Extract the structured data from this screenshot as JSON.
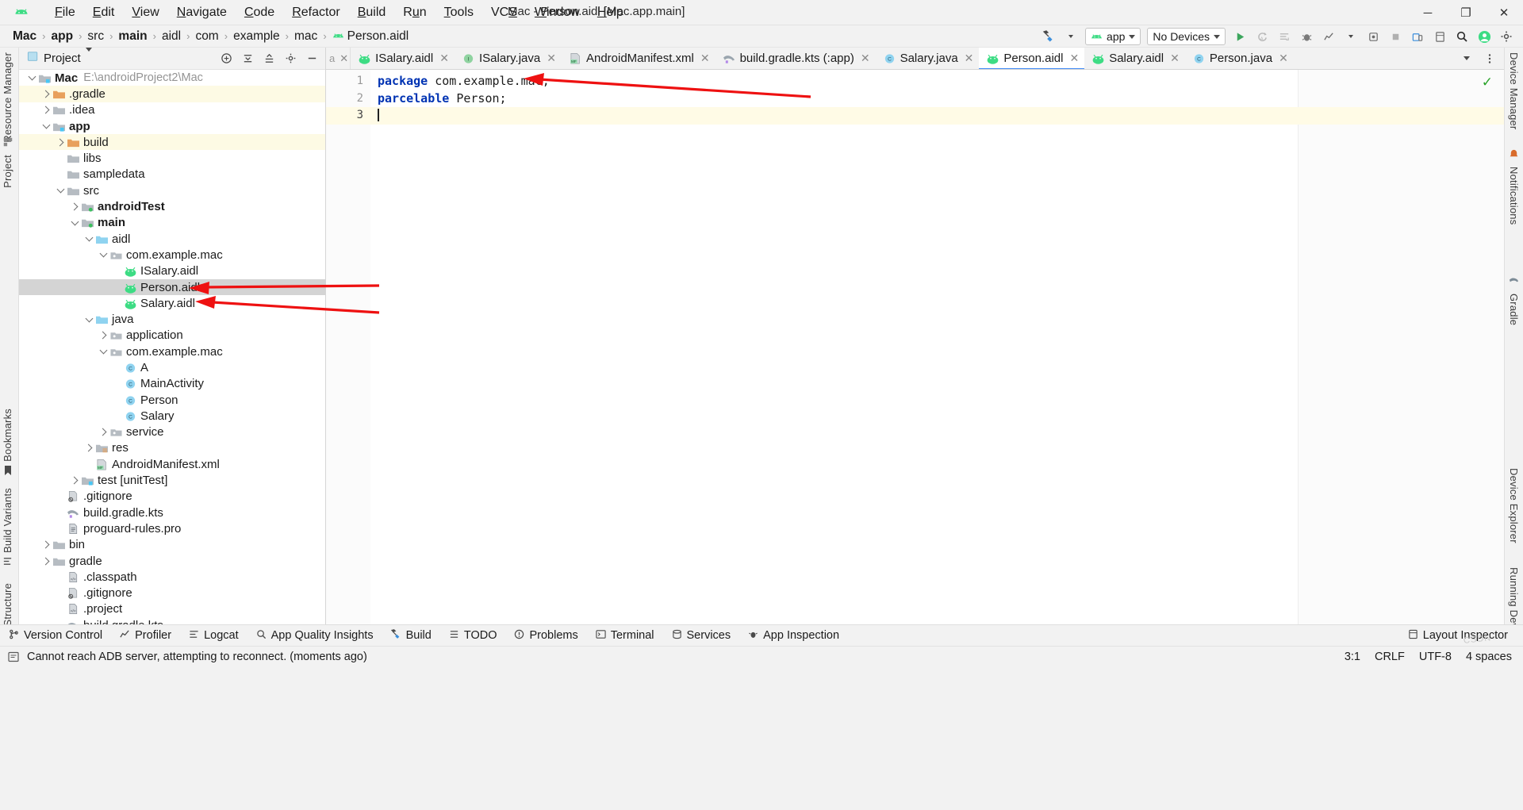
{
  "window": {
    "title": "Mac - Person.aidl [Mac.app.main]",
    "minimize": "─",
    "maximize": "❐",
    "close": "✕"
  },
  "menu": [
    {
      "label": "File"
    },
    {
      "label": "Edit"
    },
    {
      "label": "View"
    },
    {
      "label": "Navigate"
    },
    {
      "label": "Code"
    },
    {
      "label": "Refactor"
    },
    {
      "label": "Build"
    },
    {
      "label": "Run"
    },
    {
      "label": "Tools"
    },
    {
      "label": "VCS"
    },
    {
      "label": "Window"
    },
    {
      "label": "Help"
    }
  ],
  "breadcrumb": {
    "items": [
      {
        "label": "Mac",
        "bold": true
      },
      {
        "label": "app",
        "bold": true
      },
      {
        "label": "src",
        "bold": false
      },
      {
        "label": "main",
        "bold": true
      },
      {
        "label": "aidl",
        "bold": false
      },
      {
        "label": "com",
        "bold": false
      },
      {
        "label": "example",
        "bold": false
      },
      {
        "label": "mac",
        "bold": false
      },
      {
        "label": "Person.aidl",
        "bold": false,
        "icon": "android-icon"
      }
    ],
    "separator": "›"
  },
  "toolbar": {
    "build_icon": "hammer-icon",
    "run_config": "app",
    "device_selector": "No Devices",
    "run_icon": "run-icon",
    "rerun_icon": "rerun-icon",
    "apply_changes_icon": "apply-changes-icon",
    "debug_icon": "debug-icon",
    "profile_icon": "profile-icon",
    "more_run_icon": "more-run-icon",
    "attach_icon": "attach-debugger-icon",
    "stop_icon": "stop-icon",
    "device_manager_icon": "device-manager-icon",
    "layout_icon": "layout-inspector-icon",
    "search_icon": "search-everywhere-icon",
    "avatar_icon": "user-avatar-icon",
    "settings_icon": "settings-gear-icon"
  },
  "project_panel": {
    "title": "Project",
    "dropdown_icon": "chevron-down-icon",
    "actions": [
      "select-opened-file-icon",
      "collapse-all-icon",
      "expand-all-icon",
      "settings-gear-icon",
      "hide-icon"
    ],
    "tree": [
      {
        "depth": 0,
        "label": "Mac",
        "sub": "E:\\androidProject2\\Mac",
        "icon": "module-folder-icon",
        "arrow": "down",
        "bold": true,
        "state": "normal"
      },
      {
        "depth": 1,
        "label": ".gradle",
        "icon": "orange-folder-icon",
        "arrow": "right",
        "bold": false,
        "state": "highlight"
      },
      {
        "depth": 1,
        "label": ".idea",
        "icon": "grey-folder-icon",
        "arrow": "right",
        "bold": false,
        "state": "normal"
      },
      {
        "depth": 1,
        "label": "app",
        "icon": "module-folder-icon",
        "arrow": "down",
        "bold": true,
        "state": "normal"
      },
      {
        "depth": 2,
        "label": "build",
        "icon": "orange-folder-icon",
        "arrow": "right",
        "bold": false,
        "state": "highlight"
      },
      {
        "depth": 2,
        "label": "libs",
        "icon": "grey-folder-icon",
        "arrow": "none",
        "bold": false,
        "state": "normal"
      },
      {
        "depth": 2,
        "label": "sampledata",
        "icon": "grey-folder-icon",
        "arrow": "none",
        "bold": false,
        "state": "normal"
      },
      {
        "depth": 2,
        "label": "src",
        "icon": "grey-folder-icon",
        "arrow": "down",
        "bold": false,
        "state": "normal"
      },
      {
        "depth": 3,
        "label": "androidTest",
        "icon": "source-folder-icon",
        "arrow": "right",
        "bold": true,
        "state": "normal"
      },
      {
        "depth": 3,
        "label": "main",
        "icon": "source-folder-icon",
        "arrow": "down",
        "bold": true,
        "state": "normal"
      },
      {
        "depth": 4,
        "label": "aidl",
        "icon": "blue-folder-icon",
        "arrow": "down",
        "bold": false,
        "state": "normal"
      },
      {
        "depth": 5,
        "label": "com.example.mac",
        "icon": "package-icon",
        "arrow": "down",
        "bold": false,
        "state": "normal"
      },
      {
        "depth": 6,
        "label": "ISalary.aidl",
        "icon": "android-icon",
        "arrow": "none",
        "bold": false,
        "state": "normal"
      },
      {
        "depth": 6,
        "label": "Person.aidl",
        "icon": "android-icon",
        "arrow": "none",
        "bold": false,
        "state": "selected"
      },
      {
        "depth": 6,
        "label": "Salary.aidl",
        "icon": "android-icon",
        "arrow": "none",
        "bold": false,
        "state": "normal"
      },
      {
        "depth": 4,
        "label": "java",
        "icon": "blue-folder-icon",
        "arrow": "down",
        "bold": false,
        "state": "normal"
      },
      {
        "depth": 5,
        "label": "application",
        "icon": "package-icon",
        "arrow": "right",
        "bold": false,
        "state": "normal"
      },
      {
        "depth": 5,
        "label": "com.example.mac",
        "icon": "package-icon",
        "arrow": "down",
        "bold": false,
        "state": "normal"
      },
      {
        "depth": 6,
        "label": "A",
        "icon": "java-class-icon",
        "arrow": "none",
        "bold": false,
        "state": "normal"
      },
      {
        "depth": 6,
        "label": "MainActivity",
        "icon": "java-class-icon",
        "arrow": "none",
        "bold": false,
        "state": "normal"
      },
      {
        "depth": 6,
        "label": "Person",
        "icon": "java-class-icon",
        "arrow": "none",
        "bold": false,
        "state": "normal"
      },
      {
        "depth": 6,
        "label": "Salary",
        "icon": "java-class-icon",
        "arrow": "none",
        "bold": false,
        "state": "normal"
      },
      {
        "depth": 5,
        "label": "service",
        "icon": "package-icon",
        "arrow": "right",
        "bold": false,
        "state": "normal"
      },
      {
        "depth": 4,
        "label": "res",
        "icon": "res-folder-icon",
        "arrow": "right",
        "bold": false,
        "state": "normal"
      },
      {
        "depth": 4,
        "label": "AndroidManifest.xml",
        "icon": "manifest-icon",
        "arrow": "none",
        "bold": false,
        "state": "normal"
      },
      {
        "depth": 3,
        "label": "test [unitTest]",
        "icon": "test-folder-icon",
        "arrow": "right",
        "bold": false,
        "state": "normal"
      },
      {
        "depth": 2,
        "label": ".gitignore",
        "icon": "gitignore-icon",
        "arrow": "none",
        "bold": false,
        "state": "normal"
      },
      {
        "depth": 2,
        "label": "build.gradle.kts",
        "icon": "gradle-icon",
        "arrow": "none",
        "bold": false,
        "state": "normal"
      },
      {
        "depth": 2,
        "label": "proguard-rules.pro",
        "icon": "text-file-icon",
        "arrow": "none",
        "bold": false,
        "state": "normal"
      },
      {
        "depth": 1,
        "label": "bin",
        "icon": "grey-folder-icon",
        "arrow": "right",
        "bold": false,
        "state": "normal"
      },
      {
        "depth": 1,
        "label": "gradle",
        "icon": "grey-folder-icon",
        "arrow": "right",
        "bold": false,
        "state": "normal"
      },
      {
        "depth": 2,
        "label": ".classpath",
        "icon": "xml-file-icon",
        "arrow": "none",
        "bold": false,
        "state": "normal"
      },
      {
        "depth": 2,
        "label": ".gitignore",
        "icon": "gitignore-icon",
        "arrow": "none",
        "bold": false,
        "state": "normal"
      },
      {
        "depth": 2,
        "label": ".project",
        "icon": "xml-file-icon",
        "arrow": "none",
        "bold": false,
        "state": "normal"
      },
      {
        "depth": 2,
        "label": "build.gradle.kts",
        "icon": "gradle-icon",
        "arrow": "none",
        "bold": false,
        "state": "normal"
      }
    ]
  },
  "editor_tabs": [
    {
      "label": "ISalary.aidl",
      "icon": "android-icon",
      "active": false
    },
    {
      "label": "ISalary.java",
      "icon": "interface-icon",
      "active": false
    },
    {
      "label": "AndroidManifest.xml",
      "icon": "manifest-icon",
      "active": false
    },
    {
      "label": "build.gradle.kts (:app)",
      "icon": "gradle-icon",
      "active": false
    },
    {
      "label": "Salary.java",
      "icon": "java-class-icon",
      "active": false
    },
    {
      "label": "Person.aidl",
      "icon": "android-icon",
      "active": true
    },
    {
      "label": "Salary.aidl",
      "icon": "android-icon",
      "active": false
    },
    {
      "label": "Person.java",
      "icon": "java-class-icon",
      "active": false
    }
  ],
  "editor": {
    "close_label": "✕",
    "lines": [
      {
        "num": "1",
        "tokens": [
          {
            "t": "package",
            "c": "kw"
          },
          {
            "t": " com.example.mac;",
            "c": "ident"
          }
        ],
        "current": false
      },
      {
        "num": "2",
        "tokens": [
          {
            "t": "parcelable",
            "c": "kw"
          },
          {
            "t": " Person;",
            "c": "ident"
          }
        ],
        "current": false
      },
      {
        "num": "3",
        "tokens": [],
        "current": true
      }
    ],
    "inspection_status": "✓"
  },
  "bottom_tools": [
    {
      "label": "Version Control",
      "icon": "branch-icon"
    },
    {
      "label": "Profiler",
      "icon": "profiler-icon"
    },
    {
      "label": "Logcat",
      "icon": "logcat-icon"
    },
    {
      "label": "App Quality Insights",
      "icon": "insights-icon"
    },
    {
      "label": "Build",
      "icon": "build-icon"
    },
    {
      "label": "TODO",
      "icon": "todo-icon"
    },
    {
      "label": "Problems",
      "icon": "problems-icon"
    },
    {
      "label": "Terminal",
      "icon": "terminal-icon"
    },
    {
      "label": "Services",
      "icon": "services-icon"
    },
    {
      "label": "App Inspection",
      "icon": "inspection-icon"
    }
  ],
  "bottom_right": {
    "label": "Layout Inspector",
    "icon": "layout-inspector-icon"
  },
  "statusbar": {
    "message": "Cannot reach ADB server, attempting to reconnect. (moments ago)",
    "message_icon": "info-icon",
    "caret_position": "3:1",
    "line_separator": "CRLF",
    "encoding": "UTF-8",
    "indent": "4 spaces"
  },
  "left_strip": [
    {
      "label": "Resource Manager"
    },
    {
      "label": "Project"
    },
    {
      "label": "Bookmarks"
    },
    {
      "label": "Build Variants"
    },
    {
      "label": "Structure"
    }
  ],
  "right_strip": [
    {
      "label": "Device Manager"
    },
    {
      "label": "Notifications"
    },
    {
      "label": "Gradle"
    },
    {
      "label": "Device Explorer"
    },
    {
      "label": "Running Devices"
    }
  ],
  "colors": {
    "accent_blue": "#3d89f5",
    "android_green": "#3ddc84",
    "keyword_blue": "#0033b3",
    "selection_grey": "#d4d4d4",
    "highlight_yellow": "#fdfae4",
    "annotation_red": "#ee1111",
    "folder_orange": "#e8a05c",
    "folder_blue": "#8fd3f0"
  },
  "annotations": [
    {
      "name": "arrow-to-package-line"
    },
    {
      "name": "arrow-to-person-aidl"
    },
    {
      "name": "arrow-to-salary-aidl"
    }
  ]
}
